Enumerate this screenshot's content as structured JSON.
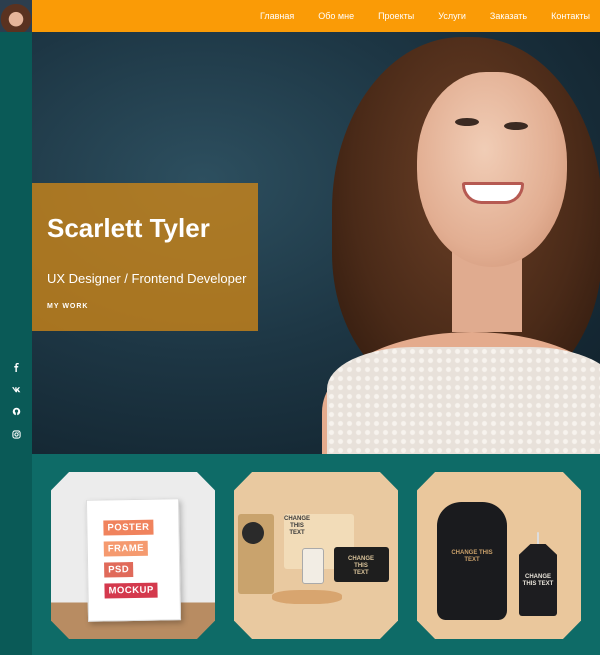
{
  "nav": {
    "items": [
      "Главная",
      "Обо мне",
      "Проекты",
      "Услуги",
      "Заказать",
      "Контакты"
    ]
  },
  "sidebar": {
    "social_icons": [
      "facebook-icon",
      "vk-icon",
      "github-icon",
      "instagram-icon"
    ]
  },
  "hero": {
    "name": "Scarlett Tyler",
    "role": "UX Designer / Frontend Developer",
    "cta": "MY WORK"
  },
  "portfolio": {
    "tile1_words": [
      "POSTER",
      "FRAME",
      "PSD",
      "MOCKUP"
    ],
    "tile2_labels": [
      "CHANGE THIS TEXT",
      "CHANGE THIS TEXT"
    ],
    "tile3_labels": [
      "CHANGE THIS TEXT",
      "CHANGE THIS TEXT"
    ]
  },
  "colors": {
    "topbar": "#fa9b06",
    "sidebar": "#0a5a57",
    "section_bg": "#0e6b67",
    "intro_box": "#d08617"
  }
}
